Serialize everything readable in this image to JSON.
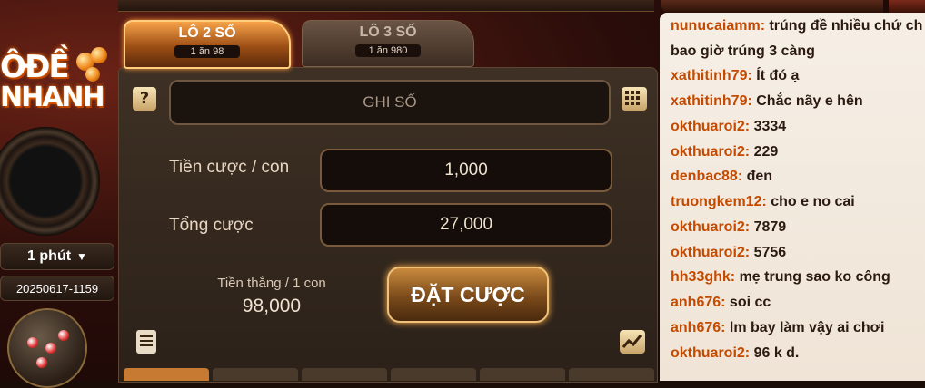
{
  "logo": {
    "line1": "ÔĐỀ",
    "line2": "NHANH"
  },
  "timer": {
    "label": "1 phút",
    "arrow": "▼"
  },
  "round_id": "20250617-1159",
  "tabs": [
    {
      "label": "LÔ 2 SỐ",
      "odds": "1 ăn 98",
      "active": true
    },
    {
      "label": "LÔ 3 SỐ",
      "odds": "1 ăn 980",
      "active": false
    }
  ],
  "entry": {
    "placeholder": "GHI SỐ",
    "help_glyph": "?"
  },
  "bet": {
    "per_unit_label": "Tiền cược / con",
    "per_unit_value": "1,000",
    "total_label": "Tổng cược",
    "total_value": "27,000",
    "win_label": "Tiền thắng / 1 con",
    "win_value": "98,000",
    "submit_label": "ĐẶT CƯỢC"
  },
  "chat": [
    {
      "user": "nunucaiamm:",
      "text": " trúng đề nhiều chứ ch"
    },
    {
      "user": "",
      "text": "bao giờ trúng 3 càng"
    },
    {
      "user": "xathitinh79:",
      "text": " Ít đó ạ"
    },
    {
      "user": "xathitinh79:",
      "text": " Chắc nãy e hên"
    },
    {
      "user": "okthuaroi2:",
      "text": " 3334"
    },
    {
      "user": "okthuaroi2:",
      "text": " 229"
    },
    {
      "user": "denbac88:",
      "text": " đen"
    },
    {
      "user": "truongkem12:",
      "text": " cho e no cai"
    },
    {
      "user": "okthuaroi2:",
      "text": " 7879"
    },
    {
      "user": "okthuaroi2:",
      "text": " 5756"
    },
    {
      "user": "hh33ghk:",
      "text": " mẹ trung sao ko công"
    },
    {
      "user": "anh676:",
      "text": " soi cc"
    },
    {
      "user": "anh676:",
      "text": " lm bay làm vậy ai chơi"
    },
    {
      "user": "okthuaroi2:",
      "text": " 96 k d."
    }
  ],
  "icons": [
    "help-icon",
    "keypad-icon",
    "history-icon",
    "trend-chart-icon"
  ],
  "colors": {
    "accent": "#f6a24a",
    "username": "#c44a00",
    "chat_bg": "#f6efe6"
  }
}
